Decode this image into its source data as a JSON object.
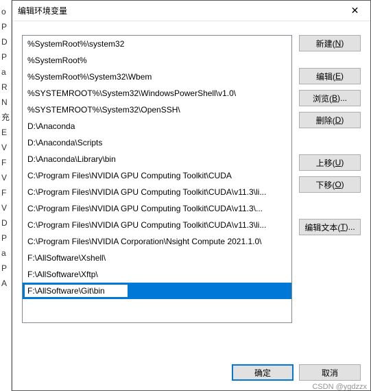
{
  "backdrop": {
    "lines": [
      "o",
      "",
      "",
      "P",
      "D",
      "P",
      "a",
      "R",
      "",
      "N",
      "",
      "",
      "充",
      "E",
      "V",
      "F",
      "V",
      "F",
      "V",
      "D",
      "P",
      "a",
      "P",
      "A"
    ]
  },
  "window": {
    "title": "编辑环境变量"
  },
  "list": {
    "items": [
      {
        "text": "%SystemRoot%\\system32",
        "state": "normal"
      },
      {
        "text": "%SystemRoot%",
        "state": "normal"
      },
      {
        "text": "%SystemRoot%\\System32\\Wbem",
        "state": "normal"
      },
      {
        "text": "%SYSTEMROOT%\\System32\\WindowsPowerShell\\v1.0\\",
        "state": "normal"
      },
      {
        "text": "%SYSTEMROOT%\\System32\\OpenSSH\\",
        "state": "normal"
      },
      {
        "text": "D:\\Anaconda",
        "state": "normal"
      },
      {
        "text": "D:\\Anaconda\\Scripts",
        "state": "normal"
      },
      {
        "text": "D:\\Anaconda\\Library\\bin",
        "state": "normal"
      },
      {
        "text": "C:\\Program Files\\NVIDIA GPU Computing Toolkit\\CUDA",
        "state": "normal"
      },
      {
        "text": "C:\\Program Files\\NVIDIA GPU Computing Toolkit\\CUDA\\v11.3\\li...",
        "state": "normal"
      },
      {
        "text": "C:\\Program Files\\NVIDIA GPU Computing Toolkit\\CUDA\\v11.3\\...",
        "state": "normal"
      },
      {
        "text": "C:\\Program Files\\NVIDIA GPU Computing Toolkit\\CUDA\\v11.3\\li...",
        "state": "normal"
      },
      {
        "text": "C:\\Program Files\\NVIDIA Corporation\\Nsight Compute 2021.1.0\\",
        "state": "normal"
      },
      {
        "text": "F:\\AllSoftware\\Xshell\\",
        "state": "normal"
      },
      {
        "text": "F:\\AllSoftware\\Xftp\\",
        "state": "normal"
      },
      {
        "text": "F:\\AllSoftware\\Git\\bin",
        "state": "editing"
      }
    ]
  },
  "buttons": {
    "new": {
      "prefix": "新建(",
      "accel": "N",
      "suffix": ")"
    },
    "edit": {
      "prefix": "编辑(",
      "accel": "E",
      "suffix": ")"
    },
    "browse": {
      "prefix": "浏览(",
      "accel": "B",
      "suffix": ")..."
    },
    "delete": {
      "prefix": "删除(",
      "accel": "D",
      "suffix": ")"
    },
    "moveup": {
      "prefix": "上移(",
      "accel": "U",
      "suffix": ")"
    },
    "movedown": {
      "prefix": "下移(",
      "accel": "O",
      "suffix": ")"
    },
    "edittext": {
      "prefix": "编辑文本(",
      "accel": "T",
      "suffix": ")..."
    }
  },
  "footer": {
    "ok": "确定",
    "cancel": "取消"
  },
  "watermark": "CSDN @ygdzzx"
}
